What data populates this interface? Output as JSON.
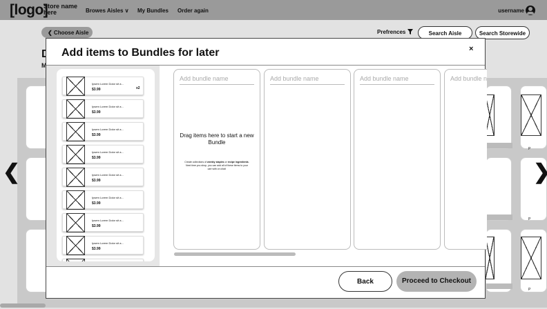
{
  "header": {
    "logo": "[logo]",
    "store_name": "Store name here",
    "nav": [
      "Browes Aisles ∨",
      "My Bundles",
      "Order again"
    ],
    "username": "username",
    "avatar_icon": "user-circle-icon"
  },
  "page": {
    "choose_aisle": "❮ Choose Aisle",
    "preferences": "Prefrences",
    "filter_icon": "funnel-icon",
    "search_aisle": "Search Aisle",
    "search_storewide": "Search Storewide",
    "title_partial": "D",
    "subtitle_partial": "M",
    "right_labels": [
      "P",
      "P",
      "P"
    ],
    "prev_arrow": "❮",
    "next_arrow": "❯"
  },
  "modal": {
    "title": "Add items to Bundles for later",
    "close": "×",
    "items": [
      {
        "name": "Ipsem Lorem Dolor sit a...",
        "price": "$3.99",
        "qty": "x2"
      },
      {
        "name": "Ipsem Lorem Dolor sit a...",
        "price": "$3.99",
        "qty": ""
      },
      {
        "name": "Ipsem Lorem Dolor sit a...",
        "price": "$3.99",
        "qty": ""
      },
      {
        "name": "Ipsem Lorem Dolor sit a...",
        "price": "$3.99",
        "qty": ""
      },
      {
        "name": "Ipsem Lorem Dolor sit a...",
        "price": "$3.99",
        "qty": ""
      },
      {
        "name": "Ipsem Lorem Dolor sit a...",
        "price": "$3.99",
        "qty": ""
      },
      {
        "name": "Ipsem Lorem Dolor sit a...",
        "price": "$3.99",
        "qty": ""
      },
      {
        "name": "Ipsem Lorem Dolor sit a...",
        "price": "$3.99",
        "qty": ""
      }
    ],
    "bundle_placeholder": "Add bundle name",
    "drag_text": "Drag items here to start a new Bundle",
    "hint_pre": "Create collections of ",
    "hint_b1": "weekly staples",
    "hint_mid": " or ",
    "hint_b2": "recipe ingredients",
    "hint_post": ". Next time you shop, you can add all of these items to your cart with on click!",
    "back_label": "Back",
    "proceed_label": "Proceed to Checkout"
  }
}
